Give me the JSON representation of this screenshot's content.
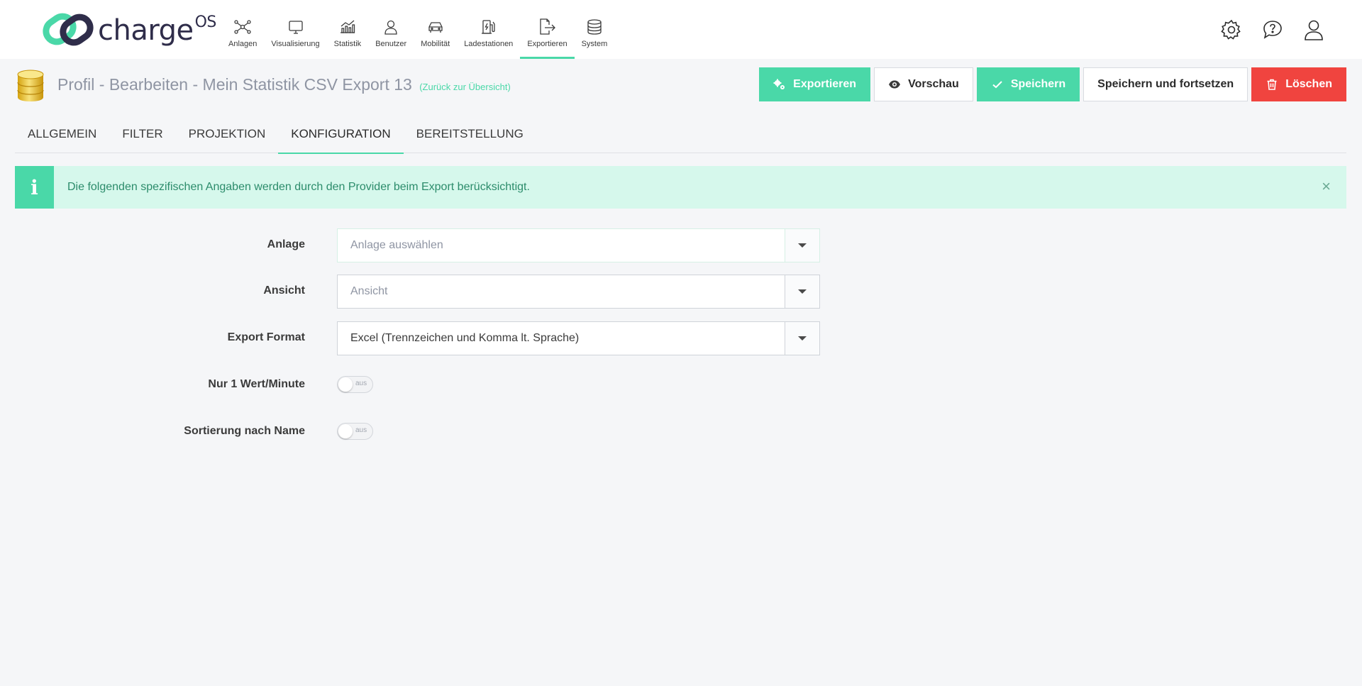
{
  "brand": {
    "name": "charge",
    "suffix": "OS",
    "accent": "#4ad8a8",
    "dark": "#2f2d4a",
    "danger": "#f0443f"
  },
  "nav": [
    {
      "label": "Anlagen",
      "icon": "network-icon"
    },
    {
      "label": "Visualisierung",
      "icon": "monitor-icon"
    },
    {
      "label": "Statistik",
      "icon": "bar-chart-icon"
    },
    {
      "label": "Benutzer",
      "icon": "user-icon"
    },
    {
      "label": "Mobilität",
      "icon": "car-icon"
    },
    {
      "label": "Ladestationen",
      "icon": "charging-station-icon"
    },
    {
      "label": "Exportieren",
      "icon": "export-icon",
      "active": true
    },
    {
      "label": "System",
      "icon": "database-icon"
    }
  ],
  "header_icons": [
    "gear-icon",
    "help-chat-icon",
    "user-profile-icon"
  ],
  "page": {
    "title": "Profil - Bearbeiten - Mein Statistik CSV Export 13",
    "back_link": "(Zurück zur Übersicht)"
  },
  "actions": {
    "export": "Exportieren",
    "preview": "Vorschau",
    "save": "Speichern",
    "save_continue": "Speichern und fortsetzen",
    "delete": "Löschen"
  },
  "tabs": [
    {
      "label": "ALLGEMEIN"
    },
    {
      "label": "FILTER"
    },
    {
      "label": "PROJEKTION"
    },
    {
      "label": "KONFIGURATION",
      "active": true
    },
    {
      "label": "BEREITSTELLUNG"
    }
  ],
  "info": {
    "icon_glyph": "i",
    "text": "Die folgenden spezifischen Angaben werden durch den Provider beim Export berücksichtigt.",
    "close_glyph": "×"
  },
  "form": {
    "anlage": {
      "label": "Anlage",
      "placeholder": "Anlage auswählen"
    },
    "ansicht": {
      "label": "Ansicht",
      "placeholder": "Ansicht"
    },
    "export_format": {
      "label": "Export Format",
      "value": "Excel (Trennzeichen und Komma lt. Sprache)"
    },
    "nur_wert": {
      "label": "Nur 1 Wert/Minute",
      "state": "aus"
    },
    "sortierung": {
      "label": "Sortierung nach Name",
      "state": "aus"
    }
  }
}
